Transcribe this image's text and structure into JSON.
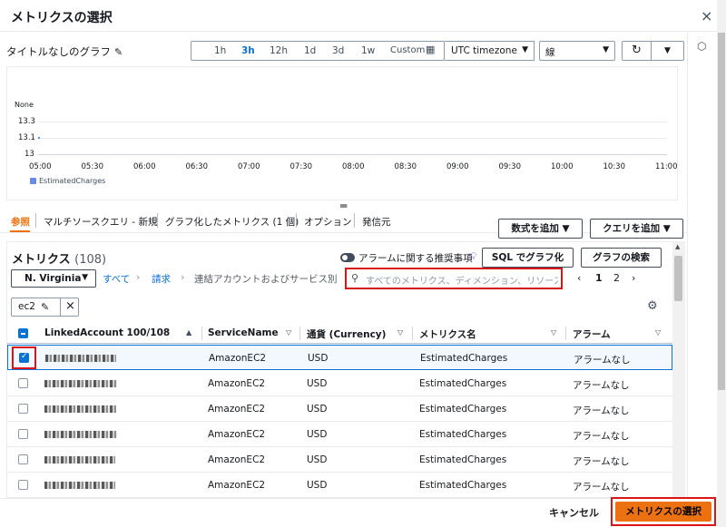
{
  "dialog": {
    "title": "メトリクスの選択",
    "close_icon": "×"
  },
  "graph": {
    "title": "タイトルなしのグラフ",
    "time_ranges": [
      "1h",
      "3h",
      "12h",
      "1d",
      "3d",
      "1w"
    ],
    "active_range": "3h",
    "custom_label": "Custom",
    "timezone": "UTC timezone",
    "graph_type": "線",
    "none_label": "None",
    "y_ticks": [
      "13.3",
      "13.1",
      "13"
    ],
    "x_ticks": [
      "05:00",
      "05:30",
      "06:00",
      "06:30",
      "07:00",
      "07:30",
      "08:00",
      "08:30",
      "09:00",
      "09:30",
      "10:00",
      "10:30",
      "11:00"
    ],
    "legend": "EstimatedCharges",
    "series_color": "#688ae8"
  },
  "chart_data": {
    "type": "line",
    "categories": [
      "05:00",
      "05:30",
      "06:00",
      "06:30",
      "07:00",
      "07:30",
      "08:00",
      "08:30",
      "09:00",
      "09:30",
      "10:00",
      "10:30",
      "11:00"
    ],
    "series": [
      {
        "name": "EstimatedCharges",
        "values": [
          13.1
        ]
      }
    ],
    "ylim": [
      13,
      13.3
    ]
  },
  "tabs": {
    "items": [
      "参照",
      "マルチソースクエリ - 新規",
      "グラフ化したメトリクス (1 個)",
      "オプション",
      "発信元"
    ],
    "active": "参照"
  },
  "actions": {
    "add_math": "数式を追加",
    "add_query": "クエリを追加"
  },
  "metrics": {
    "title": "メトリクス",
    "count": "(108)",
    "alarm_toggle_label": "アラームに関する推奨事項",
    "sql_button": "SQL でグラフ化",
    "graph_search_button": "グラフの検索",
    "region": "N. Virginia",
    "breadcrumb": [
      "すべて",
      "請求",
      "連結アカウントおよびサービス別"
    ],
    "search_placeholder": "すべてのメトリクス、ディメンション、リソース",
    "pages": [
      "1",
      "2"
    ],
    "current_page": "1",
    "filter_token": "ec2"
  },
  "table": {
    "headers": [
      "LinkedAccount 100/108",
      "ServiceName",
      "通貨 (Currency)",
      "メトリクス名",
      "アラーム"
    ],
    "rows": [
      {
        "service": "AmazonEC2",
        "currency": "USD",
        "metric": "EstimatedCharges",
        "alarm": "アラームなし",
        "checked": true
      },
      {
        "service": "AmazonEC2",
        "currency": "USD",
        "metric": "EstimatedCharges",
        "alarm": "アラームなし",
        "checked": false
      },
      {
        "service": "AmazonEC2",
        "currency": "USD",
        "metric": "EstimatedCharges",
        "alarm": "アラームなし",
        "checked": false
      },
      {
        "service": "AmazonEC2",
        "currency": "USD",
        "metric": "EstimatedCharges",
        "alarm": "アラームなし",
        "checked": false
      },
      {
        "service": "AmazonEC2",
        "currency": "USD",
        "metric": "EstimatedCharges",
        "alarm": "アラームなし",
        "checked": false
      },
      {
        "service": "AmazonEC2",
        "currency": "USD",
        "metric": "EstimatedCharges",
        "alarm": "アラームなし",
        "checked": false
      }
    ]
  },
  "footer": {
    "cancel": "キャンセル",
    "select": "メトリクスの選択"
  },
  "colors": {
    "accent": "#ec7211",
    "link": "#0972d3",
    "highlight": "#d91515"
  }
}
